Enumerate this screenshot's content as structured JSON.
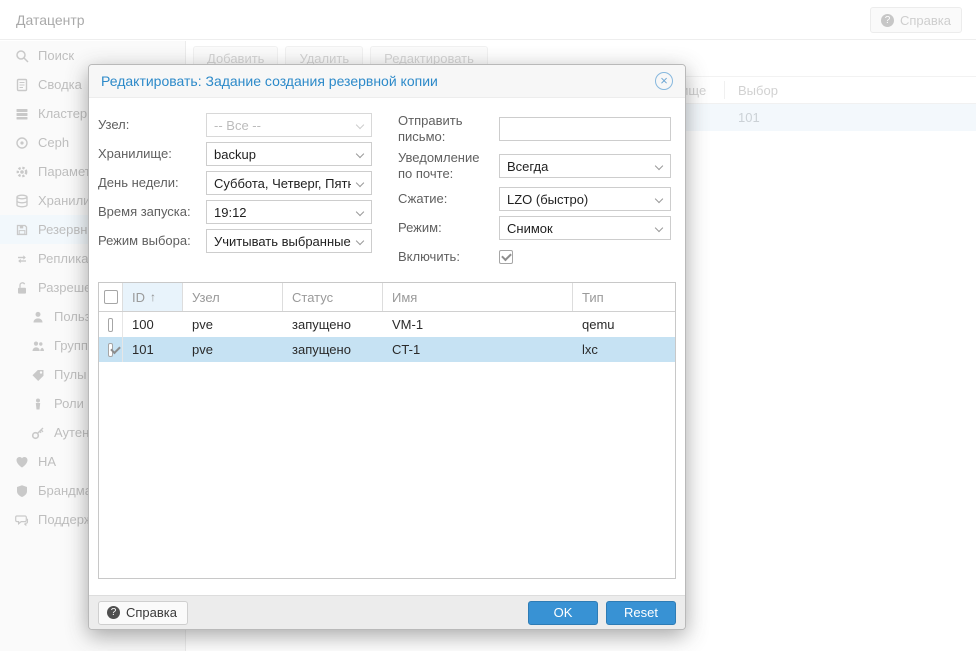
{
  "colors": {
    "accent": "#3892d4",
    "title_blue": "#2d8ac9",
    "selected_row": "#c6e2f3",
    "sidebar_selected": "#e4f0f9"
  },
  "header": {
    "title": "Датацентр",
    "help_label": "Справка"
  },
  "sidebar": {
    "items": [
      {
        "label": "Поиск",
        "icon": "search-icon"
      },
      {
        "label": "Сводка",
        "icon": "summary-book-icon"
      },
      {
        "label": "Кластер",
        "icon": "cluster-icon"
      },
      {
        "label": "Ceph",
        "icon": "ceph-icon"
      },
      {
        "label": "Параметры",
        "icon": "gear-icon"
      },
      {
        "label": "Хранилище",
        "icon": "database-icon"
      },
      {
        "label": "Резервные копии",
        "icon": "floppy-icon",
        "selected": true
      },
      {
        "label": "Репликация",
        "icon": "replication-icon"
      },
      {
        "label": "Разрешения",
        "icon": "unlock-icon"
      },
      {
        "label": "Пользователи",
        "icon": "user-icon",
        "child": true
      },
      {
        "label": "Группы",
        "icon": "groups-icon",
        "child": true
      },
      {
        "label": "Пулы",
        "icon": "tag-icon",
        "child": true
      },
      {
        "label": "Роли",
        "icon": "role-icon",
        "child": true
      },
      {
        "label": "Аутентификация",
        "icon": "key-icon",
        "child": true
      },
      {
        "label": "HA",
        "icon": "heart-icon"
      },
      {
        "label": "Брандмауэр",
        "icon": "shield-icon"
      },
      {
        "label": "Поддержка",
        "icon": "support-icon"
      }
    ]
  },
  "toolbar": {
    "add_label": "Добавить",
    "delete_label": "Удалить",
    "edit_label": "Редактировать"
  },
  "background_table": {
    "storage_header": "Хранилище",
    "selection_header": "Выбор",
    "selected_row_value": "101"
  },
  "dialog": {
    "title": "Редактировать: Задание создания резервной копии",
    "form": {
      "node": {
        "label": "Узел:",
        "value": "-- Все --",
        "disabled": true
      },
      "storage": {
        "label": "Хранилище:",
        "value": "backup"
      },
      "day_of_week": {
        "label": "День недели:",
        "value": "Суббота, Четверг, Пятница"
      },
      "start_time": {
        "label": "Время запуска:",
        "value": "19:12"
      },
      "selection_mode": {
        "label": "Режим выбора:",
        "value": "Учитывать выбранные"
      },
      "send_email": {
        "label": "Отправить письмо:",
        "value": ""
      },
      "email_notification": {
        "label": "Уведомление по почте:",
        "value": "Всегда"
      },
      "compression": {
        "label": "Сжатие:",
        "value": "LZO (быстро)"
      },
      "mode": {
        "label": "Режим:",
        "value": "Снимок"
      },
      "enable": {
        "label": "Включить:",
        "checked": true
      }
    },
    "table": {
      "columns": {
        "id": "ID",
        "node": "Узел",
        "status": "Статус",
        "name": "Имя",
        "type": "Тип"
      },
      "sort": {
        "column": "ID",
        "direction": "asc",
        "arrow": "↑"
      },
      "rows": [
        {
          "checked": false,
          "selected": false,
          "id": "100",
          "node": "pve",
          "status": "запущено",
          "name": "VM-1",
          "type": "qemu"
        },
        {
          "checked": true,
          "selected": true,
          "id": "101",
          "node": "pve",
          "status": "запущено",
          "name": "CT-1",
          "type": "lxc"
        }
      ]
    },
    "footer": {
      "help_label": "Справка",
      "ok_label": "OK",
      "reset_label": "Reset"
    }
  }
}
